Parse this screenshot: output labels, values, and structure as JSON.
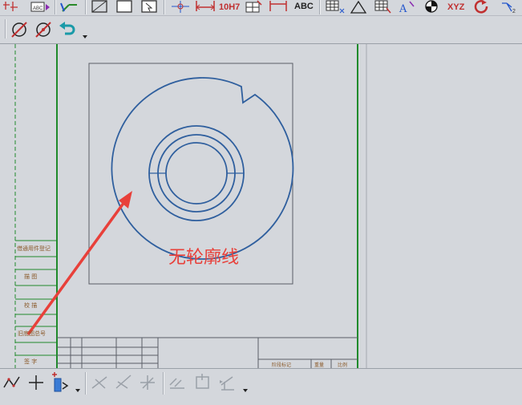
{
  "toolbar_top": {
    "dimension_tol_label": "10H7",
    "text_abc_label": "ABC",
    "coord_xyz_label": "XYZ",
    "abc_block_label": "ABC"
  },
  "drawing": {
    "annotation_text": "无轮廓线",
    "left_column_labels": [
      "借通用件登记",
      "描  图",
      "校  描",
      "旧底图总号",
      "签  字"
    ],
    "title_block_labels": [
      "阶段标记",
      "重量",
      "比例"
    ]
  },
  "colors": {
    "drawing_line": "#2f5f9e",
    "frame_green": "#1f8a2b",
    "annotation_red": "#e8403a",
    "label_brown": "#8a5a2a"
  },
  "icons": {
    "top": [
      "snap-icon",
      "text-block-icon",
      "axis-icon",
      "rect-icon",
      "box-icon",
      "pan-icon",
      "point-icon",
      "dimension-icon",
      "tolerance-icon",
      "table-icon",
      "dimension2-icon",
      "abc-text-icon",
      "grid-icon",
      "triangle-icon",
      "table2-icon",
      "text-style-icon",
      "shade-icon",
      "coord-icon",
      "refresh-icon",
      "tree-icon"
    ],
    "second": [
      "no-circle-icon",
      "no-circle2-icon",
      "undo-icon",
      "dropdown-icon"
    ],
    "bottom": [
      "polyline-icon",
      "cross-icon",
      "component-icon",
      "dropdown-icon",
      "angle-icon",
      "bisect-icon",
      "perp-icon",
      "parallel-icon",
      "box-icon",
      "tangent-icon",
      "dropdown-icon"
    ]
  }
}
